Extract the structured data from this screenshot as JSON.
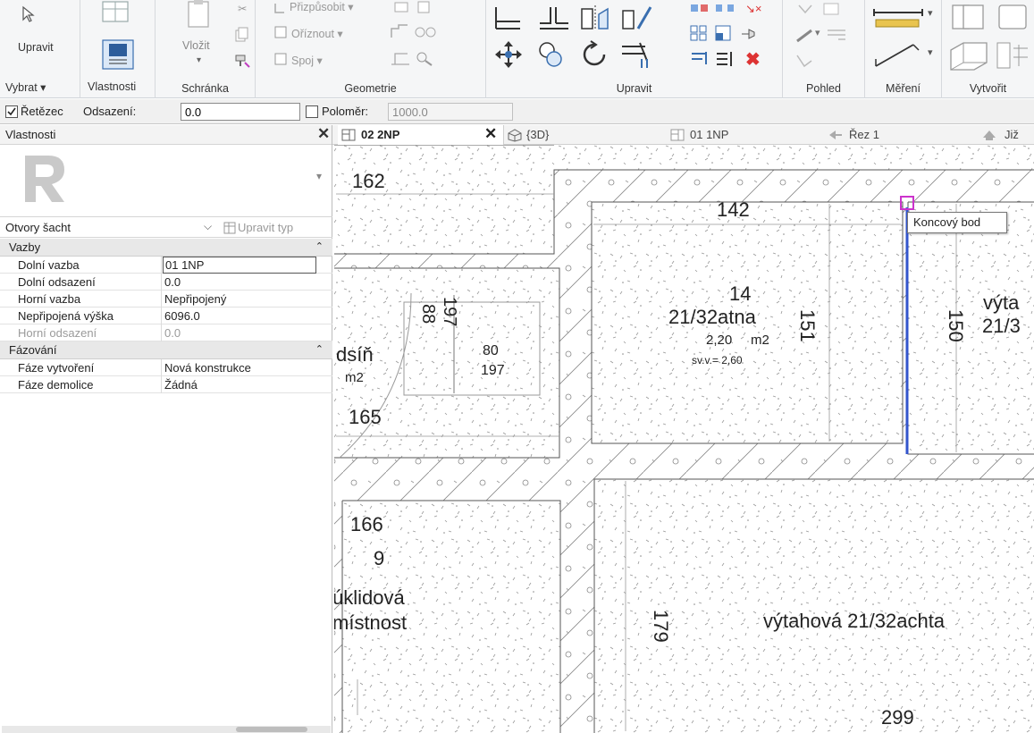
{
  "ribbon": {
    "modify_label": "Upravit",
    "select_label": "Vybrat ▾",
    "properties_label": "Vlastnosti",
    "paste_label": "Vložit",
    "fit_label": "Přizpůsobit ▾",
    "cut_label": "Oříznout ▾",
    "join_label": "Spoj ▾",
    "panels": {
      "clipboard": "Schránka",
      "geometry": "Geometrie",
      "modify": "Upravit",
      "view": "Pohled",
      "measure": "Měření",
      "create": "Vytvořit"
    }
  },
  "options_bar": {
    "chain_label": "Řetězec",
    "chain_checked": true,
    "offset_label": "Odsazení:",
    "offset_value": "0.0",
    "radius_label": "Poloměr:",
    "radius_checked": false,
    "radius_value": "1000.0"
  },
  "properties": {
    "title": "Vlastnosti",
    "type_name": "Otvory šacht",
    "edit_type_label": "Upravit typ",
    "groups": [
      {
        "name": "Vazby",
        "rows": [
          {
            "key": "Dolní vazba",
            "value": "01 1NP",
            "disabled": false
          },
          {
            "key": "Dolní odsazení",
            "value": "0.0",
            "disabled": false
          },
          {
            "key": "Horní vazba",
            "value": "Nepřipojený",
            "disabled": false
          },
          {
            "key": "Nepřipojená výška",
            "value": "6096.0",
            "disabled": false
          },
          {
            "key": "Horní odsazení",
            "value": "0.0",
            "disabled": true
          }
        ]
      },
      {
        "name": "Fázování",
        "rows": [
          {
            "key": "Fáze vytvoření",
            "value": "Nová konstrukce",
            "disabled": false
          },
          {
            "key": "Fáze demolice",
            "value": "Žádná",
            "disabled": false
          }
        ]
      }
    ]
  },
  "tabs": [
    {
      "label": "02 2NP",
      "active": true
    },
    {
      "label": "{3D}",
      "active": false
    },
    {
      "label": "01 1NP",
      "active": false
    },
    {
      "label": "Řez 1",
      "active": false
    },
    {
      "label": "Již",
      "active": false
    }
  ],
  "drawing": {
    "tooltip": "Koncový bod",
    "labels": {
      "r162": "162",
      "r142": "142",
      "r14": "14",
      "r14_name": "21/32atna",
      "r14_area": "2,20",
      "r14_area_unit": "m2",
      "r14_height": "sv.v.= 2,60",
      "d151": "151",
      "r_elev_partial": "výta",
      "r_elev_partial2": "21/3",
      "d150": "150",
      "d88": "88",
      "d197": "197",
      "d80": "80",
      "d197b": "197",
      "hall": "dsíň",
      "hall_unit": "m2",
      "r165": "165",
      "r166": "166",
      "r9": "9",
      "clean1": "úklidová",
      "clean2": "místnost",
      "d179": "179",
      "shaft": "výtahová 21/32achta",
      "r299": "299"
    }
  }
}
